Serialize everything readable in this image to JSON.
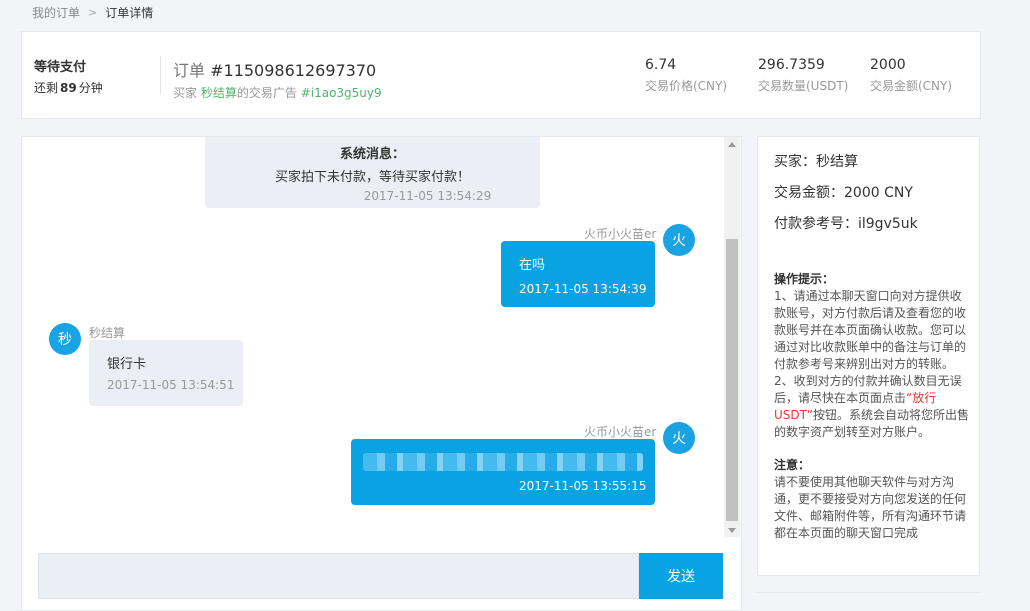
{
  "breadcrumb": {
    "parent": "我的订单",
    "separator": ">",
    "current": "订单详情"
  },
  "order": {
    "status_title": "等待支付",
    "remain_prefix": "还剩",
    "remain_minutes": "89",
    "remain_unit": "分钟",
    "order_label": "订单",
    "order_no": "#115098612697370",
    "buyer_label": "买家",
    "buyer_name": "秒结算",
    "ad_label": "的交易广告",
    "ad_id": "#i1ao3g5uy9",
    "stats": [
      {
        "value": "6.74",
        "label": "交易价格(CNY)"
      },
      {
        "value": "296.7359",
        "label": "交易数量(USDT)"
      },
      {
        "value": "2000",
        "label": "交易金额(CNY)"
      }
    ]
  },
  "chat": {
    "system": {
      "title": "系统消息：",
      "text": "买家拍下未付款，等待买家付款！",
      "time": "2017-11-05 13:54:29"
    },
    "messages": [
      {
        "side": "right",
        "nick": "火币小火苗er",
        "avatar": "火",
        "text": "在吗",
        "time": "2017-11-05 13:54:39"
      },
      {
        "side": "left",
        "nick": "秒结算",
        "avatar": "秒",
        "text": "银行卡",
        "time": "2017-11-05 13:54:51"
      },
      {
        "side": "right",
        "nick": "火币小火苗er",
        "avatar": "火",
        "text": "",
        "time": "2017-11-05 13:55:15"
      }
    ],
    "input_placeholder": "",
    "send_label": "发送"
  },
  "info": {
    "buyer": "买家：秒结算",
    "amount": "交易金额：2000 CNY",
    "ref": "付款参考号：il9gv5uk",
    "tips_title": "操作提示：",
    "tip1": "1、请通过本聊天窗口向对方提供收款账号，对方付款后请及查看您的收款账号并在本页面确认收款。您可以通过对比收款账单中的备注与订单的付款参考号来辨别出对方的转账。",
    "tip2_a": "2、收到对方的付款并确认数目无误后，请尽快在本页面点击",
    "tip2_red": "“放行USDT”",
    "tip2_b": "按钮。系统会自动将您所出售的数字资产划转至对方账户。",
    "note_title": "注意：",
    "note": "请不要使用其他聊天软件与对方沟通，更不要接受对方向您发送的任何文件、邮箱附件等，所有沟通环节请都在本页面的聊天窗口完成"
  },
  "colors": {
    "accent": "#09a3e3",
    "green": "#51b56b",
    "red": "#e53935"
  }
}
